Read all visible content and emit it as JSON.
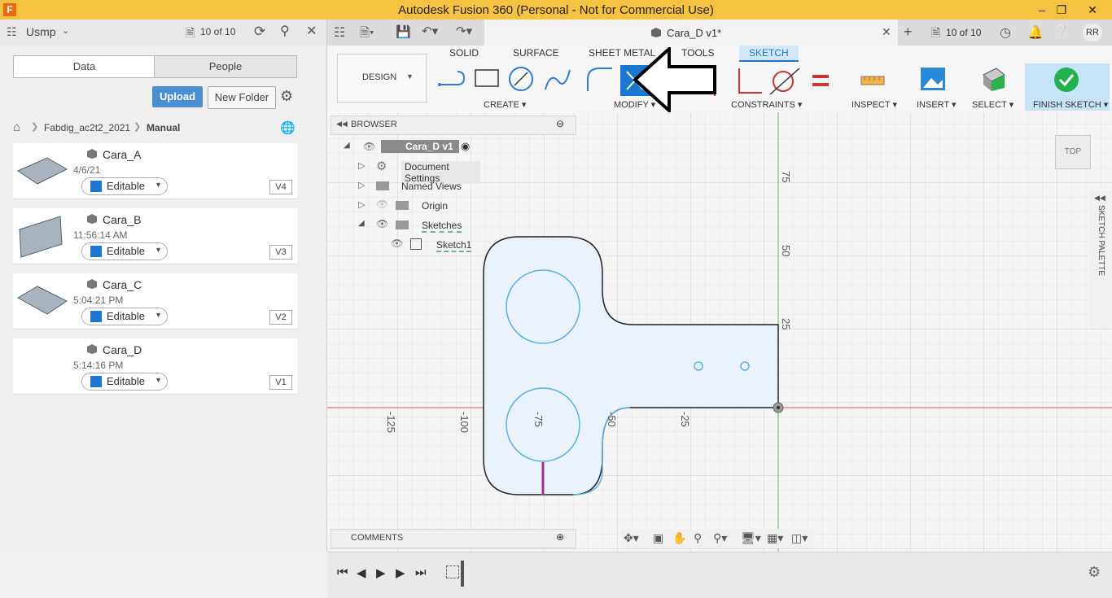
{
  "window": {
    "title": "Autodesk Fusion 360 (Personal - Not for Commercial Use)",
    "app_letter": "F"
  },
  "datapanel": {
    "team": "Usmp",
    "version_count": "10 of 10",
    "tabs": [
      "Data",
      "People"
    ],
    "upload_label": "Upload",
    "new_folder_label": "New Folder",
    "breadcrumb": {
      "project": "Fabdig_ac2t2_2021",
      "folder": "Manual"
    },
    "files": [
      {
        "name": "Cara_A",
        "date": "4/6/21",
        "status": "Editable",
        "version": "V4"
      },
      {
        "name": "Cara_B",
        "date": "11:56:14 AM",
        "status": "Editable",
        "version": "V3"
      },
      {
        "name": "Cara_C",
        "date": "5:04:21 PM",
        "status": "Editable",
        "version": "V2"
      },
      {
        "name": "Cara_D",
        "date": "5:14:16 PM",
        "status": "Editable",
        "version": "V1"
      }
    ]
  },
  "appbar": {
    "doc_tab": "Cara_D v1*",
    "version_count": "10 of 10",
    "user_initials": "RR"
  },
  "toolbar": {
    "workspace": "DESIGN",
    "tabs": [
      "SOLID",
      "SURFACE",
      "SHEET METAL",
      "TOOLS",
      "SKETCH"
    ],
    "groups": [
      "CREATE",
      "MODIFY",
      "CONSTRAINTS",
      "INSPECT",
      "INSERT",
      "SELECT",
      "FINISH SKETCH"
    ]
  },
  "browser": {
    "title": "BROWSER",
    "root": "Cara_D v1",
    "items": [
      "Document Settings",
      "Named Views",
      "Origin",
      "Sketches",
      "Sketch1"
    ]
  },
  "comments_title": "COMMENTS",
  "palette_title": "SKETCH PALETTE",
  "viewcube_label": "TOP",
  "axis_labels": {
    "x": [
      "-125",
      "-100",
      "-75",
      "-50",
      "-25"
    ],
    "y": [
      "75",
      "50",
      "25"
    ]
  },
  "colors": {
    "title_bar": "#f5c242",
    "accent_blue": "#1a78d0",
    "finish_green": "#22b14c",
    "x_axis": "#e05050",
    "y_axis": "#5fb85f"
  }
}
